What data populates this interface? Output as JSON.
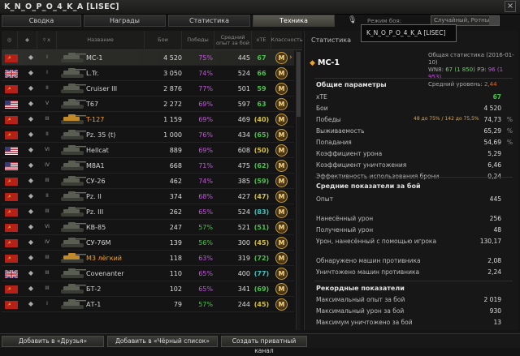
{
  "window": {
    "title": "K_N_O_P_O_4_K_A [LISEC]",
    "close": "×"
  },
  "tabs": [
    "Сводка",
    "Награды",
    "Статистика",
    "Техника"
  ],
  "battle_type": {
    "label": "Режим боя:",
    "value": "Случайный, Ротный"
  },
  "tooltip": "K_N_O_P_O_4_K_A [LISEC]",
  "columns": [
    "",
    "",
    "",
    "Название",
    "Бои",
    "Победы",
    "Средний опыт за бой",
    "xTE",
    "Классность"
  ],
  "colors": {
    "green": "#4ac24a",
    "violet": "#c05ad8",
    "blue": "#4aa8e0",
    "yellow": "#d8c32c",
    "premium": "#f2a32c"
  },
  "vehicles": [
    {
      "nation": "ussr",
      "class": "◆",
      "tier": "I",
      "name": "МС-1",
      "battles": "4 520",
      "wins": "75%",
      "exp": "445",
      "xte": "67",
      "mastery": "M",
      "wcol": "violet",
      "xcol": "green",
      "prem": false,
      "sel": true
    },
    {
      "nation": "uk",
      "class": "◆",
      "tier": "I",
      "name": "L.Tr.",
      "battles": "3 050",
      "wins": "74%",
      "exp": "524",
      "xte": "66",
      "mastery": "M",
      "wcol": "violet",
      "xcol": "green",
      "prem": false
    },
    {
      "nation": "ussr",
      "class": "◆",
      "tier": "II",
      "name": "Cruiser III",
      "battles": "2 876",
      "wins": "77%",
      "exp": "501",
      "xte": "59",
      "mastery": "M",
      "wcol": "violet",
      "xcol": "green",
      "prem": false
    },
    {
      "nation": "usa",
      "class": "◆",
      "tier": "V",
      "name": "T67",
      "battles": "2 272",
      "wins": "69%",
      "exp": "597",
      "xte": "63",
      "mastery": "M",
      "wcol": "violet",
      "xcol": "green",
      "prem": false
    },
    {
      "nation": "ussr",
      "class": "◆",
      "tier": "III",
      "name": "T-127",
      "battles": "1 159",
      "wins": "69%",
      "exp": "469",
      "xte": "(40)",
      "mastery": "M",
      "wcol": "violet",
      "xcol": "yellow",
      "prem": true
    },
    {
      "nation": "ussr",
      "class": "◆",
      "tier": "II",
      "name": "Pz. 35 (t)",
      "battles": "1 000",
      "wins": "76%",
      "exp": "434",
      "xte": "(65)",
      "mastery": "M",
      "wcol": "violet",
      "xcol": "green",
      "prem": false
    },
    {
      "nation": "usa",
      "class": "◆",
      "tier": "VI",
      "name": "Hellcat",
      "battles": "889",
      "wins": "69%",
      "exp": "608",
      "xte": "(50)",
      "mastery": "M",
      "wcol": "violet",
      "xcol": "yellow",
      "prem": false
    },
    {
      "nation": "usa",
      "class": "◆",
      "tier": "IV",
      "name": "M8A1",
      "battles": "668",
      "wins": "71%",
      "exp": "475",
      "xte": "(62)",
      "mastery": "M",
      "wcol": "violet",
      "xcol": "green",
      "prem": false
    },
    {
      "nation": "ussr",
      "class": "◆",
      "tier": "III",
      "name": "СУ-26",
      "battles": "462",
      "wins": "74%",
      "exp": "385",
      "xte": "(59)",
      "mastery": "M",
      "wcol": "violet",
      "xcol": "green",
      "prem": false
    },
    {
      "nation": "ussr",
      "class": "◆",
      "tier": "II",
      "name": "Pz. II",
      "battles": "374",
      "wins": "68%",
      "exp": "427",
      "xte": "(47)",
      "mastery": "M",
      "wcol": "violet",
      "xcol": "yellow",
      "prem": false
    },
    {
      "nation": "ussr",
      "class": "◆",
      "tier": "III",
      "name": "Pz. III",
      "battles": "262",
      "wins": "65%",
      "exp": "524",
      "xte": "(83)",
      "mastery": "M",
      "wcol": "violet",
      "xcol": "teal",
      "prem": false
    },
    {
      "nation": "ussr",
      "class": "◆",
      "tier": "VI",
      "name": "КВ-85",
      "battles": "247",
      "wins": "57%",
      "exp": "521",
      "xte": "(51)",
      "mastery": "M",
      "wcol": "green",
      "xcol": "green",
      "prem": false
    },
    {
      "nation": "ussr",
      "class": "◆",
      "tier": "IV",
      "name": "СУ-76М",
      "battles": "139",
      "wins": "56%",
      "exp": "300",
      "xte": "(45)",
      "mastery": "M",
      "wcol": "green",
      "xcol": "yellow",
      "prem": false
    },
    {
      "nation": "ussr",
      "class": "◆",
      "tier": "III",
      "name": "М3 лёгкий",
      "battles": "118",
      "wins": "63%",
      "exp": "319",
      "xte": "(72)",
      "mastery": "M",
      "wcol": "violet",
      "xcol": "green",
      "prem": true
    },
    {
      "nation": "uk",
      "class": "◆",
      "tier": "III",
      "name": "Covenanter",
      "battles": "110",
      "wins": "65%",
      "exp": "400",
      "xte": "(77)",
      "mastery": "M",
      "wcol": "violet",
      "xcol": "teal",
      "prem": false
    },
    {
      "nation": "ussr",
      "class": "◆",
      "tier": "III",
      "name": "БТ-2",
      "battles": "102",
      "wins": "65%",
      "exp": "341",
      "xte": "(69)",
      "mastery": "M",
      "wcol": "violet",
      "xcol": "green",
      "prem": false
    },
    {
      "nation": "ussr",
      "class": "◆",
      "tier": "I",
      "name": "АТ-1",
      "battles": "79",
      "wins": "57%",
      "exp": "244",
      "xte": "(45)",
      "mastery": "M",
      "wcol": "green",
      "xcol": "yellow",
      "prem": false
    }
  ],
  "panel": {
    "tab": "Статистика",
    "vehicle": "МС-1",
    "general_title": "Общая статистика (2016-01-10)",
    "wn8_label": "WN8:",
    "wn8": "67 (1 850)",
    "re_label": "РЭ:",
    "re": "96 (1 953)",
    "avg_tier_label": "Средний уровень:",
    "avg_tier": "2,44",
    "s1": {
      "title": "Общие параметры",
      "rows": [
        {
          "k": "xTE",
          "v": "67",
          "pct": ""
        },
        {
          "k": "Бои",
          "v": "4 520",
          "pct": ""
        },
        {
          "k": "Победы",
          "v": "74,73",
          "pct": "%",
          "ex": "48 до 75% / 142 до 75,5%"
        },
        {
          "k": "Выживаемость",
          "v": "65,29",
          "pct": "%"
        },
        {
          "k": "Попадания",
          "v": "54,69",
          "pct": "%"
        },
        {
          "k": "Коэффициент урона",
          "v": "5,29",
          "pct": ""
        },
        {
          "k": "Коэффициент уничтожения",
          "v": "6,46",
          "pct": ""
        },
        {
          "k": "Эффективность использования брони",
          "v": "0,24",
          "pct": ""
        }
      ]
    },
    "s2": {
      "title": "Средние показатели за бой",
      "rows": [
        {
          "k": "Опыт",
          "v": "445"
        },
        {
          "k": "Нанесённый урон",
          "v": "256"
        },
        {
          "k": "Полученный урон",
          "v": "48"
        },
        {
          "k": "Урон, нанесённый с помощью игрока",
          "v": "130,17"
        },
        {
          "k": "Обнаружено машин противника",
          "v": "2,08"
        },
        {
          "k": "Уничтожено машин противника",
          "v": "2,24"
        }
      ]
    },
    "s3": {
      "title": "Рекордные показатели",
      "rows": [
        {
          "k": "Максимальный опыт за бой",
          "v": "2 019"
        },
        {
          "k": "Максимальный урон за бой",
          "v": "930"
        },
        {
          "k": "Максимум уничтожено за бой",
          "v": "13"
        }
      ]
    }
  },
  "buttons": {
    "friends": "Добавить в «Друзья»",
    "blacklist": "Добавить в «Чёрный список»",
    "channel": "Создать приватный канал"
  }
}
